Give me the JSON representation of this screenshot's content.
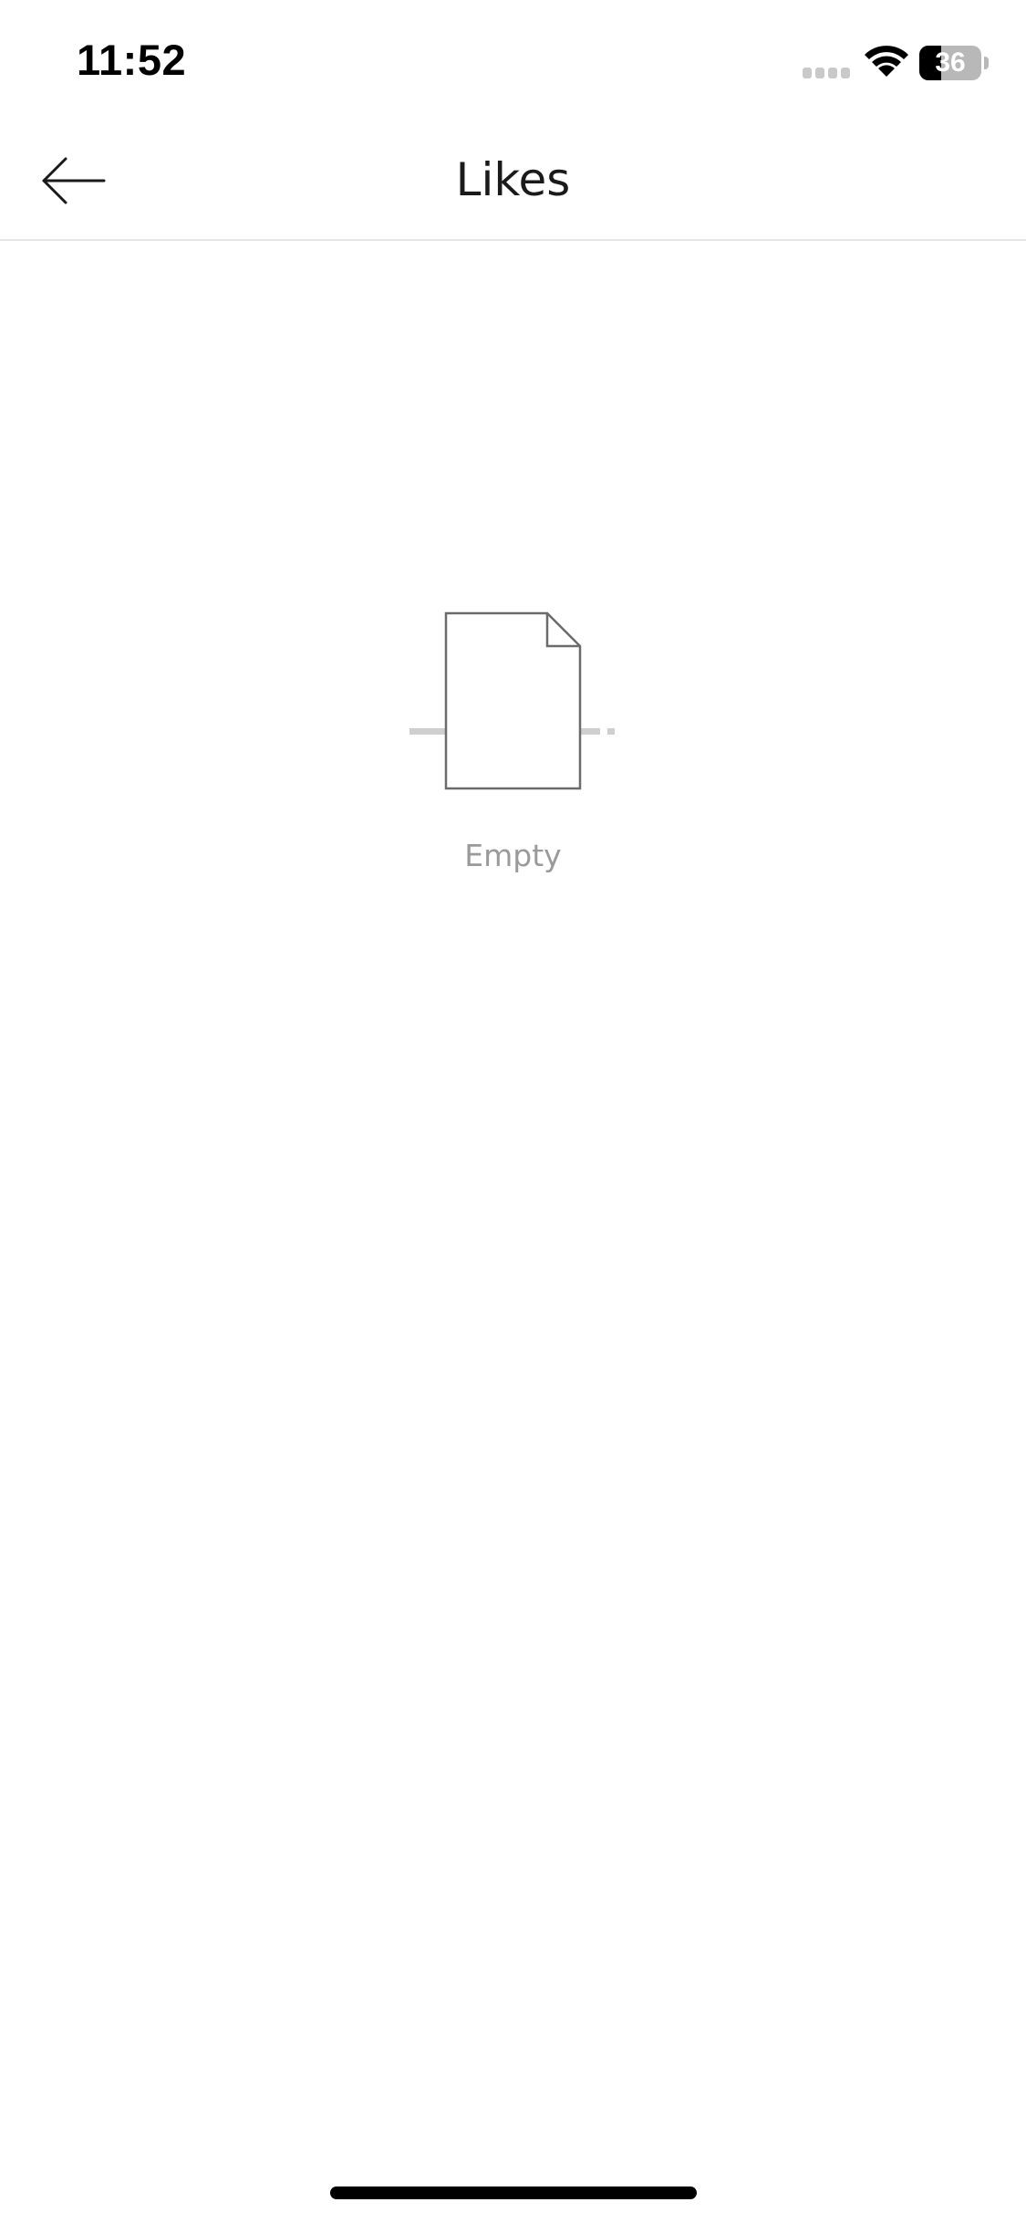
{
  "status_bar": {
    "time": "11:52",
    "battery_level": "36",
    "battery_percent": 36,
    "signal_icon": "cellular-signal-icon",
    "wifi_icon": "wifi-icon"
  },
  "nav": {
    "title": "Likes",
    "back_icon": "arrow-left-icon"
  },
  "empty_state": {
    "label": "Empty",
    "icon": "blank-document-icon"
  },
  "colors": {
    "background": "#ffffff",
    "title_text": "#1a1a1a",
    "muted_text": "#9a9a9a",
    "divider": "#e6e6e6",
    "illustration_stroke": "#6b6b6b",
    "illustration_accent": "#cfcfcf"
  }
}
